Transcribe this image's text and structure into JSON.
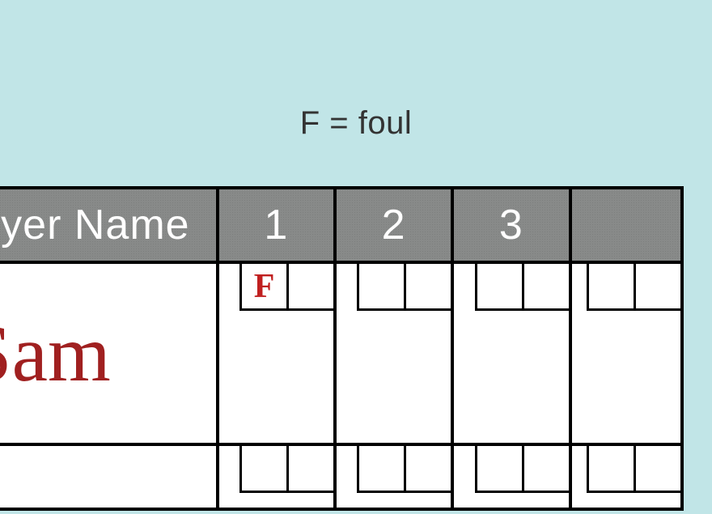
{
  "legend": "F = foul",
  "headers": {
    "name": "yer Name",
    "frame1": "1",
    "frame2": "2",
    "frame3": "3"
  },
  "player": {
    "name": "Sam",
    "frame1_roll1": "F",
    "frame1_roll2": "",
    "frame2_roll1": "",
    "frame2_roll2": "",
    "frame3_roll1": "",
    "frame3_roll2": ""
  }
}
